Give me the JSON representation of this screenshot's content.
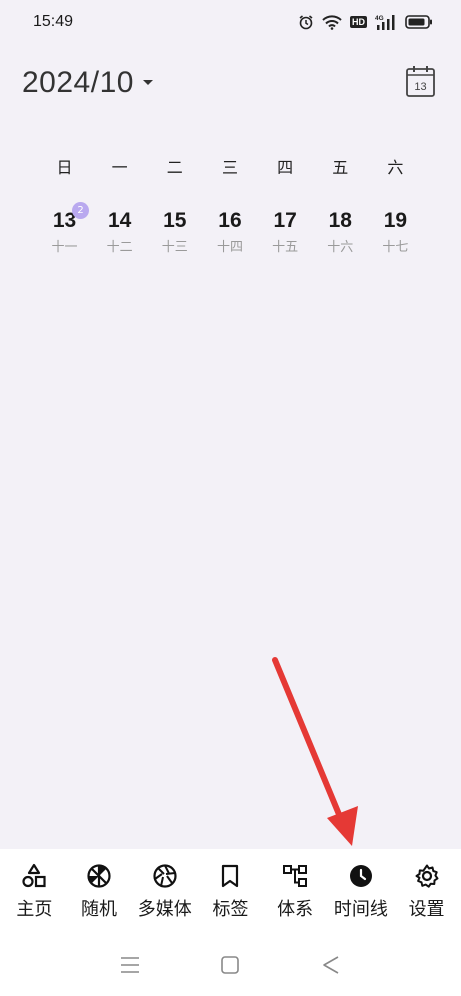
{
  "status_bar": {
    "time": "15:49",
    "hd_label": "HD",
    "network_label": "4G",
    "icons": [
      "alarm-icon",
      "wifi-icon",
      "hd-icon",
      "signal-icon",
      "battery-icon"
    ]
  },
  "header": {
    "month": "2024/10",
    "calendar_icon_day": "13"
  },
  "weekdays": [
    "日",
    "一",
    "二",
    "三",
    "四",
    "五",
    "六"
  ],
  "days": [
    {
      "num": "13",
      "lunar": "十一",
      "badge": "2"
    },
    {
      "num": "14",
      "lunar": "十二"
    },
    {
      "num": "15",
      "lunar": "十三"
    },
    {
      "num": "16",
      "lunar": "十四"
    },
    {
      "num": "17",
      "lunar": "十五"
    },
    {
      "num": "18",
      "lunar": "十六"
    },
    {
      "num": "19",
      "lunar": "十七"
    }
  ],
  "bottom_nav": [
    {
      "label": "主页",
      "icon": "shapes-icon"
    },
    {
      "label": "随机",
      "icon": "random-icon"
    },
    {
      "label": "多媒体",
      "icon": "aperture-icon"
    },
    {
      "label": "标签",
      "icon": "bookmark-icon"
    },
    {
      "label": "体系",
      "icon": "hierarchy-icon"
    },
    {
      "label": "时间线",
      "icon": "clock-icon"
    },
    {
      "label": "设置",
      "icon": "gear-icon"
    }
  ],
  "colors": {
    "background": "#f3f1f7",
    "badge": "#b9a9ef",
    "arrow": "#e53935",
    "nav_background": "#ffffff"
  }
}
